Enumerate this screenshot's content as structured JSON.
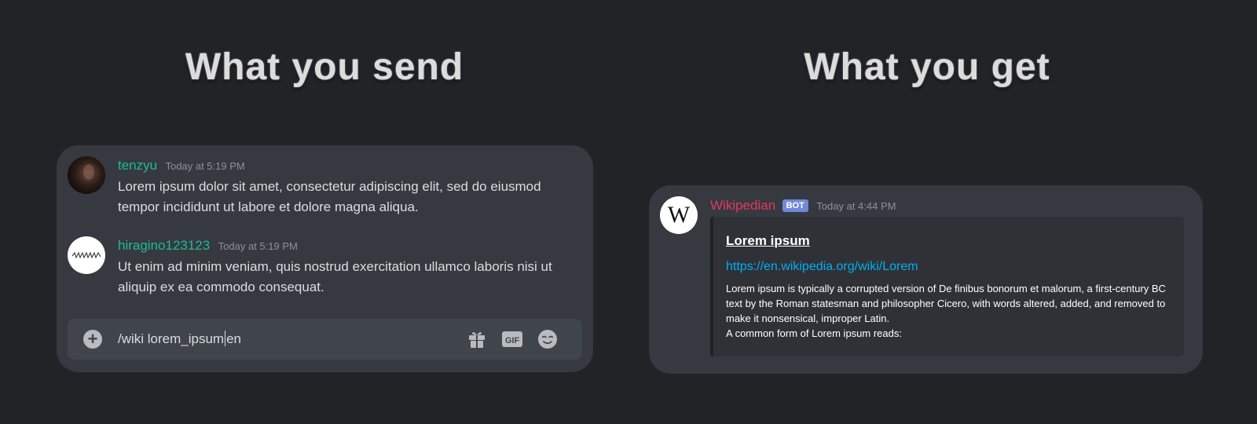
{
  "headings": {
    "send": "What you send",
    "get": "What you get"
  },
  "send_panel": {
    "messages": [
      {
        "username": "tenzyu",
        "timestamp": "Today at 5:19 PM",
        "text": "Lorem ipsum dolor sit amet, consectetur adipiscing elit, sed do eiusmod tempor incididunt ut labore et dolore magna aliqua."
      },
      {
        "username": "hiragino123123",
        "timestamp": "Today at 5:19 PM",
        "text": "Ut enim ad minim veniam, quis nostrud exercitation ullamco laboris nisi ut aliquip ex ea commodo consequat."
      }
    ],
    "composer": {
      "text_before_caret": "/wiki lorem_ipsum",
      "text_after_caret": "en",
      "icons": [
        "plus-icon",
        "gift-icon",
        "gif-icon",
        "emoji-icon"
      ]
    }
  },
  "get_panel": {
    "avatar_letter": "W",
    "username": "Wikipedian",
    "badge": "BOT",
    "timestamp": "Today at 4:44 PM",
    "embed": {
      "title": "Lorem ipsum",
      "url": "https://en.wikipedia.org/wiki/Lorem",
      "description": "Lorem ipsum is typically a corrupted version of De finibus bonorum et malorum, a first-century BC text by the Roman statesman and philosopher Cicero, with words altered, added, and removed to make it nonsensical, improper Latin.",
      "description_line2": "A common form of Lorem ipsum reads:"
    }
  },
  "colors": {
    "background": "#222327",
    "card": "#36393f",
    "composer": "#40444b",
    "embed": "#2f3136",
    "username_teal": "#1abc9c",
    "bot_username": "#e03a5c",
    "bot_badge": "#7289da",
    "link": "#00aff4"
  }
}
